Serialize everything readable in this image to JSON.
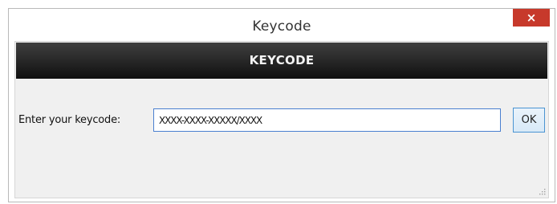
{
  "window": {
    "title": "Keycode",
    "close_glyph": "×"
  },
  "header": {
    "title": "KEYCODE"
  },
  "form": {
    "label": "Enter your keycode:",
    "input_value": "XXXX-XXXX-XXXXX/XXXX",
    "ok_label": "OK"
  },
  "colors": {
    "close_button": "#c7392b",
    "header_banner": "#1e1e1e",
    "input_border": "#4a7fd0",
    "ok_border": "#4a94d2"
  },
  "icons": {
    "close": "close-icon",
    "resize": "resize-grip-icon"
  }
}
